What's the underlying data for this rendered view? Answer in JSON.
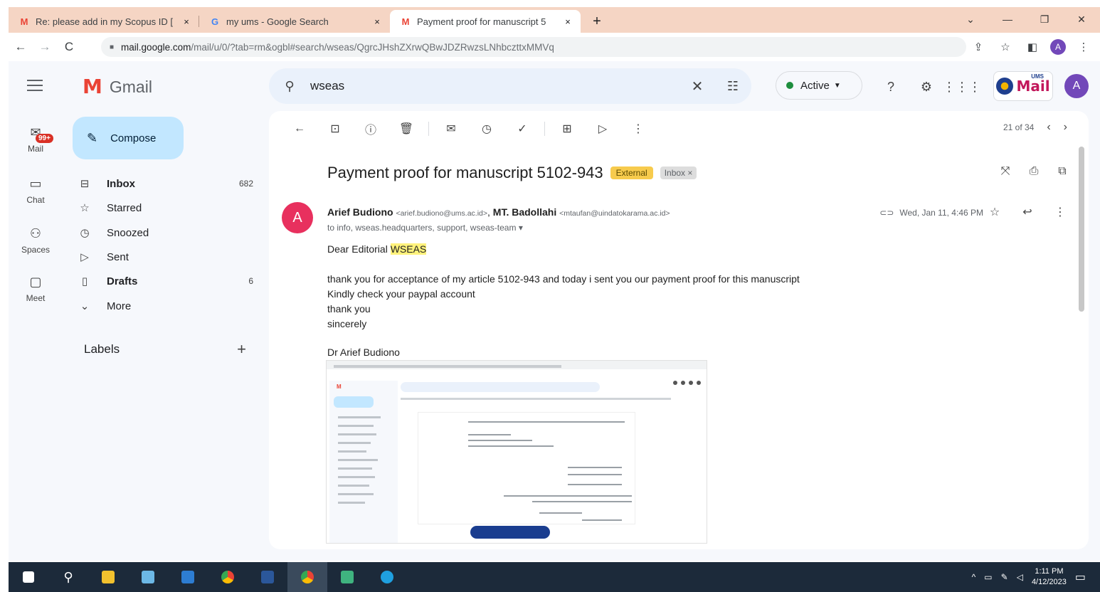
{
  "browser": {
    "tabs": [
      {
        "title": "Re: please add in my Scopus ID [",
        "favicon": "gmail-icon",
        "close": "×",
        "active": false
      },
      {
        "title": "my ums - Google Search",
        "favicon": "google-icon",
        "close": "×",
        "active": false
      },
      {
        "title": "Payment proof for manuscript 5",
        "favicon": "gmail-icon",
        "close": "×",
        "active": true
      }
    ],
    "new_tab": "+",
    "window_controls": [
      "⌄",
      "—",
      "❐",
      "✕"
    ],
    "url_host": "mail.google.com",
    "url_path": "/mail/u/0/?tab=rm&ogbl#search/wseas/QgrcJHshZXrwQBwJDZRwzsLNhbczttxMMVq",
    "profile_initial": "A"
  },
  "gmail": {
    "logo_letter": "M",
    "logo_word": "Gmail",
    "search_value": "wseas",
    "status": "Active",
    "org_logo_text": "Mail",
    "org_logo_small": "UMS",
    "account_initial": "A",
    "rail": [
      {
        "label": "Mail",
        "badge": "99+",
        "icon": "mail-icon"
      },
      {
        "label": "Chat",
        "icon": "chat-icon"
      },
      {
        "label": "Spaces",
        "icon": "spaces-icon"
      },
      {
        "label": "Meet",
        "icon": "meet-icon"
      }
    ],
    "compose_label": "Compose",
    "nav": [
      {
        "label": "Inbox",
        "count": "682",
        "bold": true,
        "icon": "inbox-icon"
      },
      {
        "label": "Starred",
        "count": "",
        "bold": false,
        "icon": "star-icon"
      },
      {
        "label": "Snoozed",
        "count": "",
        "bold": false,
        "icon": "clock-icon"
      },
      {
        "label": "Sent",
        "count": "",
        "bold": false,
        "icon": "send-icon"
      },
      {
        "label": "Drafts",
        "count": "6",
        "bold": true,
        "icon": "draft-icon"
      },
      {
        "label": "More",
        "count": "",
        "bold": false,
        "icon": "chevron-down-icon"
      }
    ],
    "labels_title": "Labels"
  },
  "message": {
    "pager": "21 of 34",
    "subject": "Payment proof for manuscript 5102-943",
    "tag_external": "External",
    "tag_inbox": "Inbox ×",
    "sender_initial": "A",
    "sender1_name": "Arief Budiono",
    "sender1_email": "<arief.budiono@ums.ac.id>",
    "sender_sep": ",",
    "sender2_name": "MT. Badollahi",
    "sender2_email": "<mtaufan@uindatokarama.ac.id>",
    "to_line": "to info, wseas.headquarters, support, wseas-team",
    "date": "Wed, Jan 11, 4:46 PM",
    "greeting_prefix": "Dear Editorial ",
    "greeting_highlight": "WSEAS",
    "body_lines": [
      "thank you for acceptance of my article 5102-943 and today i sent you our payment proof for this manuscript",
      "Kindly check your paypal account",
      "thank you",
      "sincerely"
    ],
    "signature": "Dr Arief Budiono"
  },
  "taskbar": {
    "time": "1:11 PM",
    "date": "4/12/2023"
  }
}
